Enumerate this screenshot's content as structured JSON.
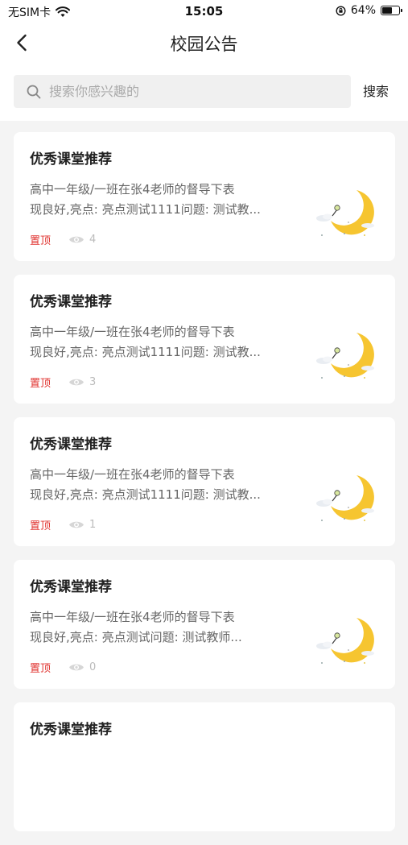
{
  "status_bar": {
    "carrier": "无SIM卡",
    "time": "15:05",
    "battery_percent": "64%",
    "battery_level": 0.64
  },
  "nav": {
    "title": "校园公告",
    "back_icon": "chevron-left-icon"
  },
  "search": {
    "placeholder": "搜索你感兴趣的",
    "value": "",
    "button_label": "搜索"
  },
  "colors": {
    "top_tag": "#e0332f",
    "moon": "#f6c530",
    "background": "#f4f4f4"
  },
  "notices": [
    {
      "title": "优秀课堂推荐",
      "line1": "高中一年级/一班在张4老师的督导下表",
      "line2": "现良好,亮点: 亮点测试1111问题: 测试教...",
      "tag": "置顶",
      "views": "4"
    },
    {
      "title": "优秀课堂推荐",
      "line1": "高中一年级/一班在张4老师的督导下表",
      "line2": "现良好,亮点: 亮点测试1111问题: 测试教...",
      "tag": "置顶",
      "views": "3"
    },
    {
      "title": "优秀课堂推荐",
      "line1": "高中一年级/一班在张4老师的督导下表",
      "line2": "现良好,亮点: 亮点测试1111问题: 测试教...",
      "tag": "置顶",
      "views": "1"
    },
    {
      "title": "优秀课堂推荐",
      "line1": "高中一年级/一班在张4老师的督导下表",
      "line2": "现良好,亮点: 亮点测试问题: 测试教师...",
      "tag": "置顶",
      "views": "0"
    },
    {
      "title": "优秀课堂推荐",
      "line1": "",
      "line2": "",
      "tag": "",
      "views": ""
    }
  ]
}
